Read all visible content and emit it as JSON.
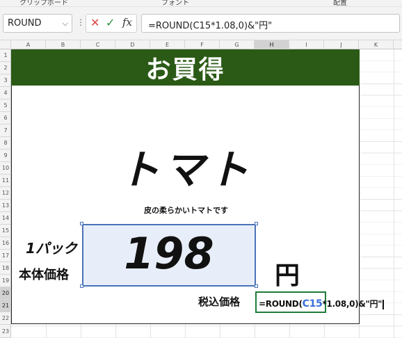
{
  "ribbon": {
    "group_clipboard": "クリップボード",
    "group_font": "フォント",
    "group_align": "配置"
  },
  "formula_bar": {
    "name_box": "ROUND",
    "formula": "=ROUND(C15*1.08,0)&\"円\"",
    "cancel_icon": "✕",
    "enter_icon": "✓",
    "fx_label": "fx"
  },
  "columns": [
    "A",
    "B",
    "C",
    "D",
    "E",
    "F",
    "G",
    "H",
    "I",
    "J",
    "K"
  ],
  "rows": [
    "1",
    "2",
    "3",
    "4",
    "5",
    "6",
    "7",
    "8",
    "9",
    "10",
    "11",
    "12",
    "13",
    "14",
    "15",
    "16",
    "17",
    "18",
    "19",
    "20",
    "21",
    "22",
    "23"
  ],
  "selected_column": "H",
  "selected_rows": [
    "20",
    "21"
  ],
  "sheet": {
    "title": "お買得",
    "product": "トマト",
    "subtitle": "皮の柔らかいトマトです",
    "pack_label": "1パック",
    "body_price_label": "本体価格",
    "price": "198",
    "yen": "円",
    "tax_label": "税込価格",
    "edit_prefix": "=ROUND(",
    "edit_ref": "C15",
    "edit_suffix": "*1.08,0)&\"円\""
  },
  "colors": {
    "title_band": "#2b5a16",
    "selection_border": "#4a72b8",
    "selection_fill": "#e8eef9",
    "edit_border": "#1f7a3a",
    "cell_ref": "#3a6fd8"
  }
}
